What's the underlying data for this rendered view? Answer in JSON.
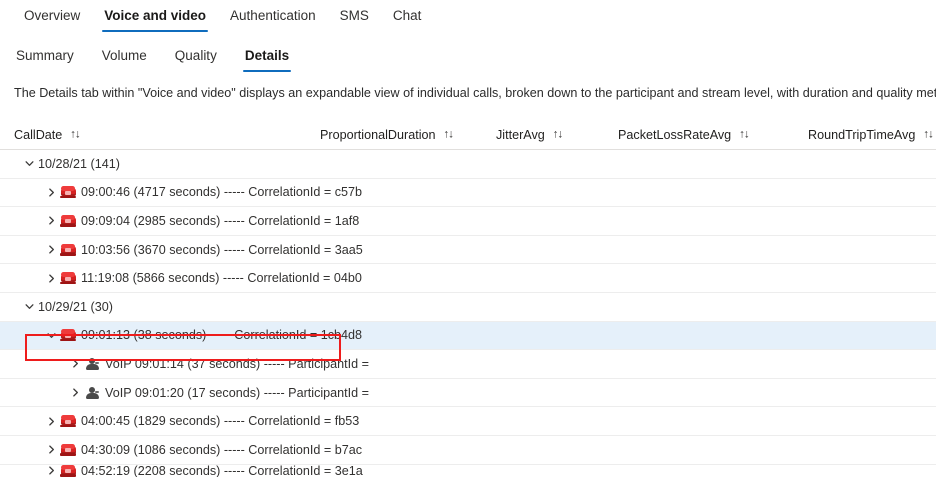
{
  "tabs": {
    "items": [
      {
        "label": "Overview",
        "active": false
      },
      {
        "label": "Voice and video",
        "active": true
      },
      {
        "label": "Authentication",
        "active": false
      },
      {
        "label": "SMS",
        "active": false
      },
      {
        "label": "Chat",
        "active": false
      }
    ]
  },
  "subtabs": {
    "items": [
      {
        "label": "Summary",
        "active": false
      },
      {
        "label": "Volume",
        "active": false
      },
      {
        "label": "Quality",
        "active": false
      },
      {
        "label": "Details",
        "active": true
      }
    ]
  },
  "description": {
    "text": "The Details tab within \"Voice and video\" displays an expandable view of individual calls, broken down to the participant and stream level, with duration and quality metrics."
  },
  "table": {
    "columns": [
      {
        "label": "CallDate",
        "sort_icon": "sort-updown-icon",
        "sort_glyph": "↑↓"
      },
      {
        "label": "ProportionalDuration",
        "sort_icon": "sort-updown-icon",
        "sort_glyph": "↑↓"
      },
      {
        "label": "JitterAvg",
        "sort_icon": "sort-updown-icon",
        "sort_glyph": "↑↓"
      },
      {
        "label": "PacketLossRateAvg",
        "sort_icon": "sort-updown-icon",
        "sort_glyph": "↑↓"
      },
      {
        "label": "RoundTripTimeAvg",
        "sort_icon": "sort-updown-icon",
        "sort_glyph": "↑↓"
      }
    ],
    "rows": [
      {
        "type": "group",
        "level": 0,
        "expanded": true,
        "icon": "none",
        "text": "10/28/21 (141)",
        "selected": false
      },
      {
        "type": "call",
        "level": 1,
        "expanded": false,
        "icon": "telephone-icon",
        "text": "09:00:46 (4717 seconds) ----- CorrelationId = c57b",
        "selected": false
      },
      {
        "type": "call",
        "level": 1,
        "expanded": false,
        "icon": "telephone-icon",
        "text": "09:09:04 (2985 seconds) ----- CorrelationId = 1af8",
        "selected": false
      },
      {
        "type": "call",
        "level": 1,
        "expanded": false,
        "icon": "telephone-icon",
        "text": "10:03:56 (3670 seconds) ----- CorrelationId = 3aa5",
        "selected": false
      },
      {
        "type": "call",
        "level": 1,
        "expanded": false,
        "icon": "telephone-icon",
        "text": "11:19:08 (5866 seconds) ----- CorrelationId = 04b0",
        "selected": false
      },
      {
        "type": "group",
        "level": 0,
        "expanded": true,
        "icon": "none",
        "text": "10/29/21 (30)",
        "selected": false
      },
      {
        "type": "call",
        "level": 1,
        "expanded": true,
        "icon": "telephone-icon",
        "text": "09:01:13 (38 seconds) ----- CorrelationId = 1cb4d8",
        "selected": true
      },
      {
        "type": "participant",
        "level": 2,
        "expanded": false,
        "icon": "voip-participant-icon",
        "text": "VoIP 09:01:14 (37 seconds) ----- ParticipantId =",
        "selected": false
      },
      {
        "type": "participant",
        "level": 2,
        "expanded": false,
        "icon": "voip-participant-icon",
        "text": "VoIP 09:01:20 (17 seconds) ----- ParticipantId =",
        "selected": false
      },
      {
        "type": "call",
        "level": 1,
        "expanded": false,
        "icon": "telephone-icon",
        "text": "04:00:45 (1829 seconds) ----- CorrelationId = fb53",
        "selected": false
      },
      {
        "type": "call",
        "level": 1,
        "expanded": false,
        "icon": "telephone-icon",
        "text": "04:30:09 (1086 seconds) ----- CorrelationId = b7ac",
        "selected": false
      },
      {
        "type": "call",
        "level": 1,
        "expanded": false,
        "icon": "telephone-icon",
        "text": "04:52:19 (2208 seconds) ----- CorrelationId = 3e1a",
        "selected": false,
        "clipped": true
      }
    ]
  },
  "annotation": {
    "name": "red-highlight-rectangle",
    "color": "#ee1c1c"
  },
  "colors": {
    "accent": "#0f6cbd",
    "selected_row": "#e5f0fa",
    "annotation_red": "#ee1c1c",
    "row_divider": "#ededed",
    "text": "#323130"
  }
}
